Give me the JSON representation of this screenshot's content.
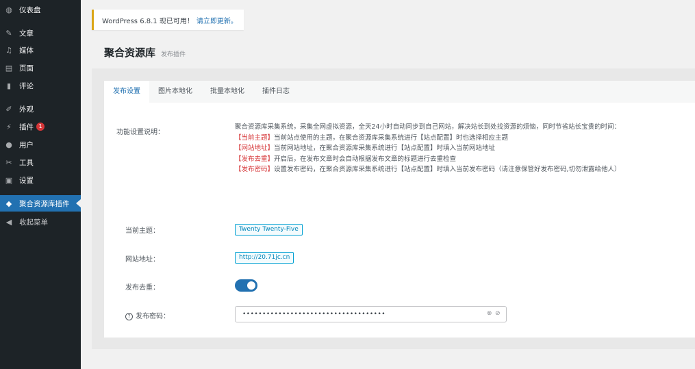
{
  "sidebar": {
    "items": [
      {
        "label": "仪表盘",
        "icon": "dashboard-icon",
        "glyph": "◍"
      },
      {
        "label": "文章",
        "icon": "pin-icon",
        "glyph": "✎"
      },
      {
        "label": "媒体",
        "icon": "media-icon",
        "glyph": "♫"
      },
      {
        "label": "页面",
        "icon": "page-icon",
        "glyph": "▤"
      },
      {
        "label": "评论",
        "icon": "comment-icon",
        "glyph": "▮"
      },
      {
        "label": "外观",
        "icon": "appearance-icon",
        "glyph": "✐"
      },
      {
        "label": "插件",
        "icon": "plugin-icon",
        "glyph": "⚡",
        "badge": "1"
      },
      {
        "label": "用户",
        "icon": "user-icon",
        "glyph": "●"
      },
      {
        "label": "工具",
        "icon": "tools-icon",
        "glyph": "✂"
      },
      {
        "label": "设置",
        "icon": "settings-icon",
        "glyph": "▣"
      },
      {
        "label": "聚合资源库插件",
        "icon": "shield-icon",
        "glyph": "◆"
      },
      {
        "label": "收起菜单",
        "icon": "collapse-icon",
        "glyph": "◀"
      }
    ]
  },
  "notice": {
    "text": "WordPress 6.8.1 现已可用！",
    "link": "请立即更新。"
  },
  "page": {
    "title": "聚合资源库",
    "subtitle": "发布插件"
  },
  "tabs": [
    "发布设置",
    "图片本地化",
    "批量本地化",
    "插件日志"
  ],
  "form": {
    "desc_label": "功能设置说明：",
    "desc_intro": "聚合资源库采集系统，采集全网虚拟资源，全天24小时自动同步到自己网站，解决站长到处找资源的烦恼，同时节省站长宝贵的时间：",
    "desc_lines": [
      {
        "tag": "【当前主题】",
        "text": "当前站点使用的主题，在聚合资源库采集系统进行【站点配置】时也选择相应主题"
      },
      {
        "tag": "【网站地址】",
        "text": "当前网站地址，在聚合资源库采集系统进行【站点配置】时填入当前网站地址"
      },
      {
        "tag": "【发布去重】",
        "text": "开启后，在发布文章时会自动根据发布文章的标题进行去重检查"
      },
      {
        "tag": "【发布密码】",
        "text": "设置发布密码，在聚合资源库采集系统进行【站点配置】时填入当前发布密码（请注意保管好发布密码,切勿泄露给他人）"
      }
    ],
    "theme_label": "当前主题：",
    "theme_value": "Twenty Twenty-Five",
    "site_label": "网站地址：",
    "site_value": "http://20.71jc.cn",
    "dedupe_label": "发布去重：",
    "dedupe_on": true,
    "password_label": "发布密码：",
    "password_value": "••••••••••••••••••••••••••••••••••••"
  },
  "colors": {
    "sidebar_bg": "#1d2327",
    "accent": "#2271b1",
    "danger": "#d63638"
  }
}
